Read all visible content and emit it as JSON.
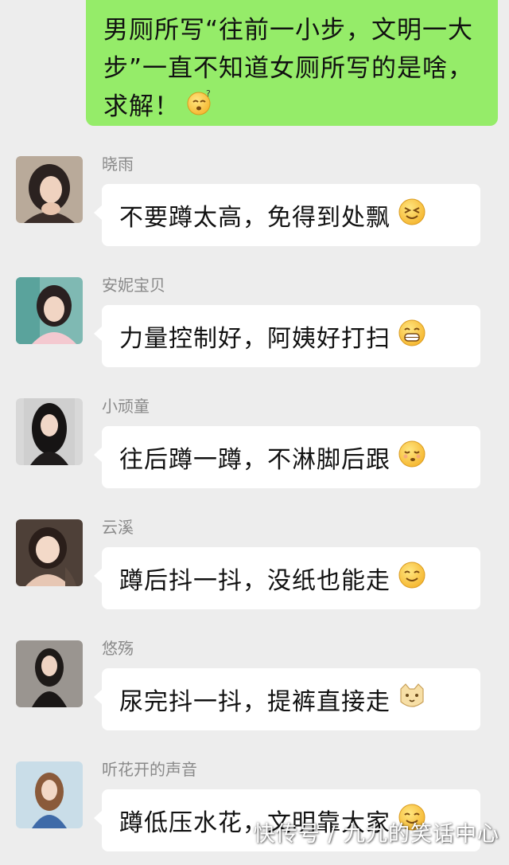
{
  "self_message": {
    "text": "男厕所写“往前一小步，文明一大步”一直不知道女厕所写的是啥，求解！",
    "emoji": "thinking-question-face"
  },
  "messages": [
    {
      "name": "晓雨",
      "text": "不要蹲太高，免得到处飘",
      "emoji": "squinting-smile-face"
    },
    {
      "name": "安妮宝贝",
      "text": "力量控制好，阿姨好打扫",
      "emoji": "grinning-teeth-face"
    },
    {
      "name": "小顽童",
      "text": "往后蹲一蹲，不淋脚后跟",
      "emoji": "relieved-face"
    },
    {
      "name": "云溪",
      "text": "蹲后抖一抖，没纸也能走",
      "emoji": "smiling-face"
    },
    {
      "name": "悠殇",
      "text": "尿完抖一抖，提裤直接走",
      "emoji": "cat-face"
    },
    {
      "name": "听花开的声音",
      "text": "蹲低压水花，文明靠大家",
      "emoji": "smiling-face"
    }
  ],
  "watermark": "快传号 / 九九的笑话中心",
  "colors": {
    "self_bubble": "#95ec69",
    "background": "#ededed",
    "bubble": "#ffffff",
    "name": "#8a8a8a"
  }
}
